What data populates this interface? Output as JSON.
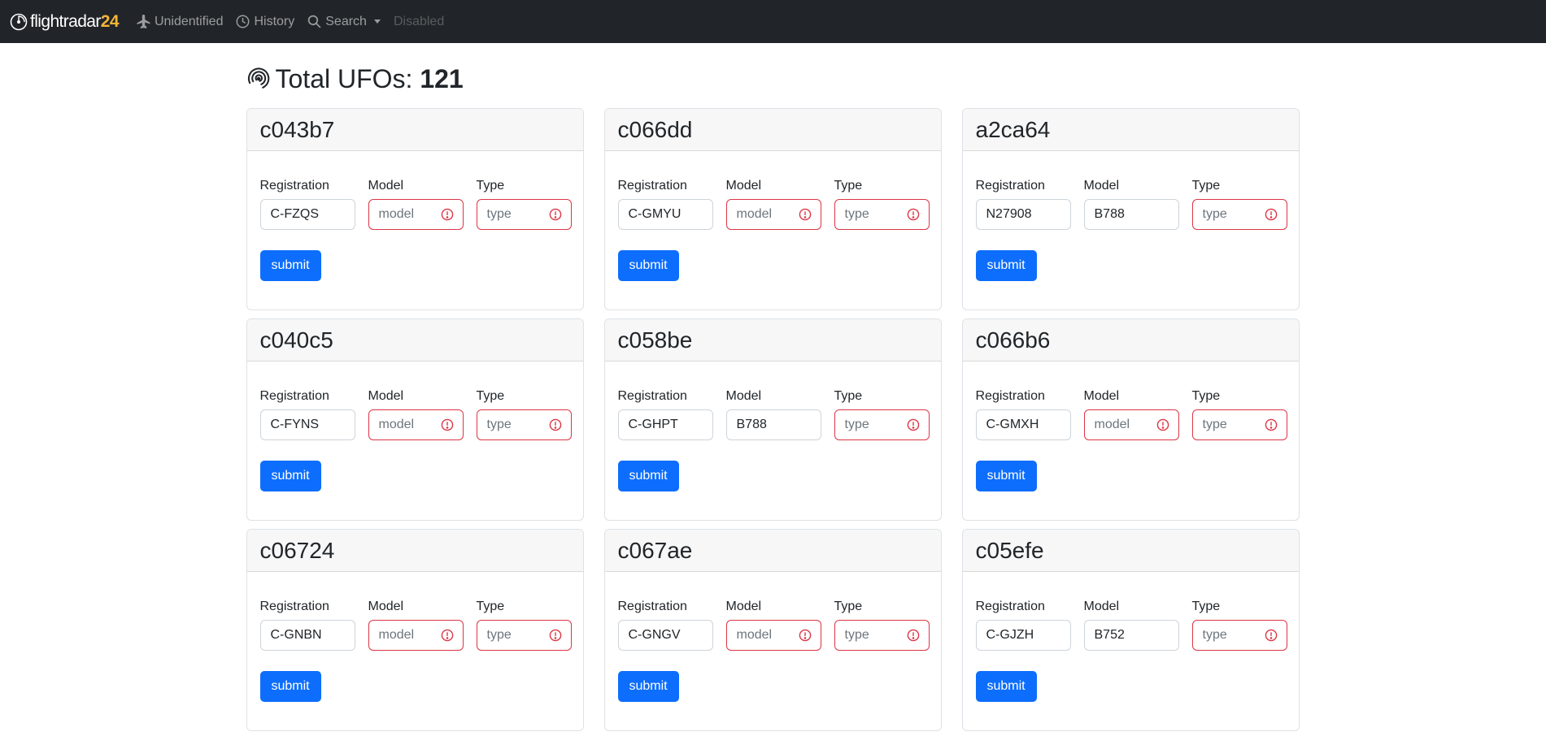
{
  "navbar": {
    "brand": "flightradar",
    "brand_num": "24",
    "items": [
      {
        "label": "Unidentified",
        "icon": "airplane-icon"
      },
      {
        "label": "History",
        "icon": "clock-icon"
      },
      {
        "label": "Search",
        "icon": "search-icon"
      },
      {
        "label": "Disabled"
      }
    ]
  },
  "header": {
    "title_prefix": "Total UFOs:",
    "total": "121",
    "icon": "radar-icon"
  },
  "labels": {
    "registration": "Registration",
    "model": "Model",
    "type": "Type",
    "submit": "submit"
  },
  "placeholders": {
    "model": "model",
    "type": "type"
  },
  "colors": {
    "navbar_bg": "#212529",
    "brand_accent": "#f4b43a",
    "primary": "#0d6efd",
    "invalid": "#dc3545"
  },
  "cards": [
    {
      "id": "c043b7",
      "registration": "C-FZQS",
      "model": "",
      "type": ""
    },
    {
      "id": "c066dd",
      "registration": "C-GMYU",
      "model": "",
      "type": ""
    },
    {
      "id": "a2ca64",
      "registration": "N27908",
      "model": "B788",
      "type": ""
    },
    {
      "id": "c040c5",
      "registration": "C-FYNS",
      "model": "",
      "type": ""
    },
    {
      "id": "c058be",
      "registration": "C-GHPT",
      "model": "B788",
      "type": ""
    },
    {
      "id": "c066b6",
      "registration": "C-GMXH",
      "model": "",
      "type": ""
    },
    {
      "id": "c06724",
      "registration": "C-GNBN",
      "model": "",
      "type": ""
    },
    {
      "id": "c067ae",
      "registration": "C-GNGV",
      "model": "",
      "type": ""
    },
    {
      "id": "c05efe",
      "registration": "C-GJZH",
      "model": "B752",
      "type": ""
    }
  ]
}
